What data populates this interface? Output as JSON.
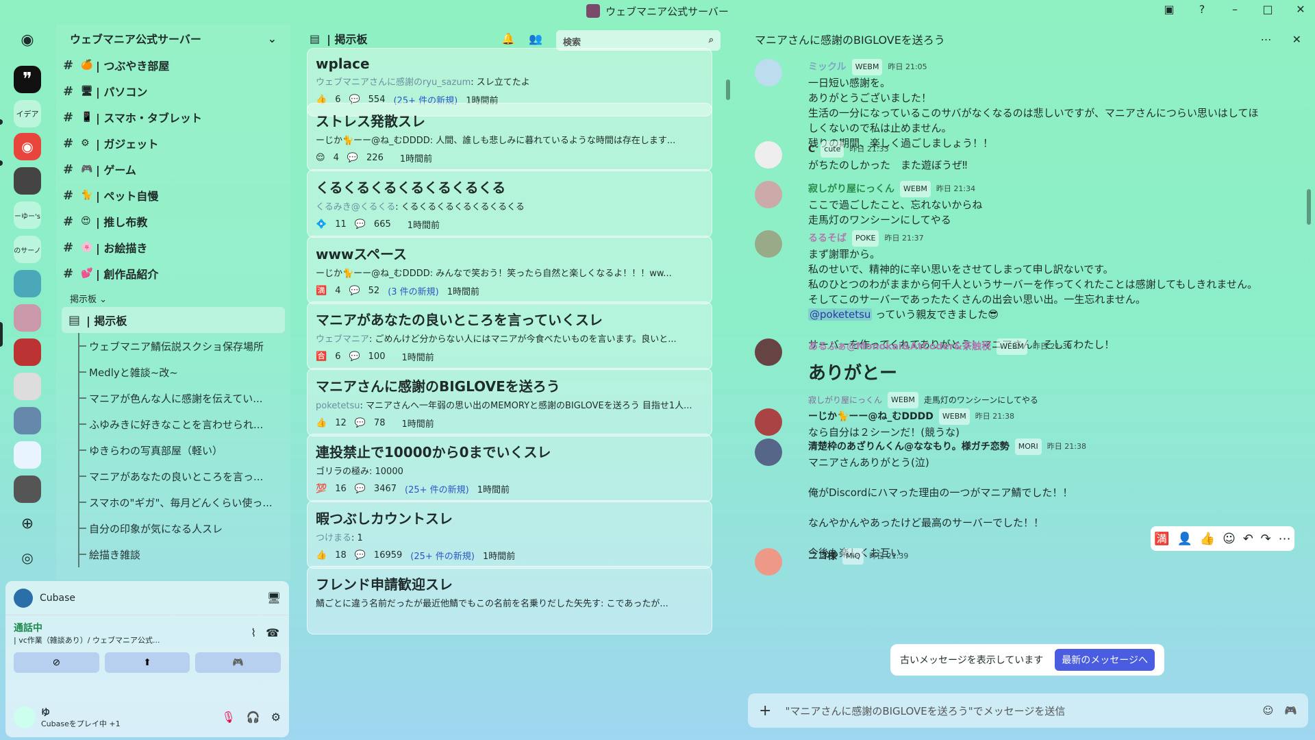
{
  "titlebar": {
    "title": "ウェブマニア公式サーバー"
  },
  "guilds": {
    "idea_label": "イデア",
    "item_a": "ーゆー's",
    "item_b": "のサーノ"
  },
  "server": {
    "name": "ウェブマニア公式サーバー"
  },
  "channels": [
    {
      "emoji": "🍊",
      "name": "| つぶやき部屋"
    },
    {
      "emoji": "🖥",
      "name": "| パソコン"
    },
    {
      "emoji": "📱",
      "name": "| スマホ・タブレット"
    },
    {
      "emoji": "⚙",
      "name": "| ガジェット"
    },
    {
      "emoji": "🎮",
      "name": "| ゲーム"
    },
    {
      "emoji": "🐈",
      "name": "| ペット自慢"
    },
    {
      "emoji": "😍",
      "name": "| 推し布教"
    },
    {
      "emoji": "🌸",
      "name": "| お絵描き"
    },
    {
      "emoji": "💕",
      "name": "| 創作品紹介"
    }
  ],
  "category": "掲示板",
  "active_channel": "| 掲示板",
  "threads": [
    "ウェブマニア鯖伝説スクショ保存場所",
    "Medlyと雑談~改~",
    "マニアが色んな人に感謝を伝えてい...",
    "ふゆみきに好きなことを言わせられ...",
    "ゆきらわの写真部屋（軽い）",
    "マニアがあなたの良いところを言っ...",
    "スマホの\"ギガ\"、毎月どんくらい使っ...",
    "自分の印象が気になる人スレ",
    "絵描き雑談"
  ],
  "userpanel": {
    "app": "Cubase",
    "call_status": "通話中",
    "call_channel": "| vc作業（雑談あり）/ ウェブマニア公式...",
    "username": "ゆ",
    "activity": "Cubaseをプレイ中 +1"
  },
  "forum": {
    "title": "| 掲示板",
    "search_placeholder": "検索",
    "posts": [
      {
        "title": "wplace",
        "author": "ウェブマニアさんに感謝のryu_sazum",
        "preview": ": スレ立てたよ",
        "reaction": "👍",
        "rcount": "6",
        "replies": "554",
        "new": "(25+ 件の新規)",
        "time": "1時間前"
      },
      {
        "title": "ストレス発散スレ",
        "author": "",
        "preview": "ーじか🐈ーー@ね_むDDDD: 人間、誰しも悲しみに暮れているような時間は存在します...",
        "reaction": "😌",
        "rcount": "4",
        "replies": "226",
        "new": "",
        "time": "1時間前"
      },
      {
        "title": "くるくるくるくるくるくるくる",
        "author": "くるみき@くるくる",
        "preview": ": くるくるくるくるくるくるくる",
        "reaction": "💠",
        "rcount": "11",
        "replies": "665",
        "new": "",
        "time": "1時間前"
      },
      {
        "title": "wwwスペース",
        "author": "",
        "preview": "ーじか🐈ーー@ね_むDDDD: みんなで笑おう！笑ったら自然と楽しくなるよ！！！ww...",
        "reaction": "🈵",
        "rcount": "4",
        "replies": "52",
        "new": "(3 件の新規)",
        "time": "1時間前"
      },
      {
        "title": "マニアがあなたの良いところを言っていくスレ",
        "author": "ウェブマニア",
        "preview": ": ごめんけど分からない人にはマニアが今食べたいものを言います。良いと...",
        "reaction": "🈴",
        "rcount": "6",
        "replies": "100",
        "new": "",
        "time": "1時間前"
      },
      {
        "title": "マニアさんに感謝のBIGLOVEを送ろう",
        "author": "poketetsu",
        "preview": ": マニアさんへ一年弱の思い出のMEMORYと感謝のBIGLOVEを送ろう 目指せ1人...",
        "reaction": "👍",
        "rcount": "12",
        "replies": "78",
        "new": "",
        "time": "1時間前"
      },
      {
        "title": "連投禁止で10000から0までいくスレ",
        "author": "",
        "preview": "ゴリラの極み: 10000",
        "reaction": "💯",
        "rcount": "16",
        "replies": "3467",
        "new": "(25+ 件の新規)",
        "time": "1時間前"
      },
      {
        "title": "暇つぶしカウントスレ",
        "author": "つけまる",
        "preview": ": 1",
        "reaction": "👍",
        "rcount": "18",
        "replies": "16959",
        "new": "(25+ 件の新規)",
        "time": "1時間前"
      },
      {
        "title": "フレンド申請歓迎スレ",
        "author": "",
        "preview": "鯖ごとに違う名前だったが最近他鯖でもこの名前を名乗りだした矢先す: こであったが...",
        "reaction": "",
        "rcount": "",
        "replies": "",
        "new": "",
        "time": ""
      }
    ]
  },
  "thread": {
    "title": "マニアさんに感謝のBIGLOVEを送ろう",
    "messages": [
      {
        "name": "ミックル",
        "tag": "WEBM",
        "ts": "昨日 21:05",
        "lines": [
          "一日短い感謝を。",
          "ありがとうございました！",
          "生活の一分になっているこのサバがなくなるのは悲しいですが、マニアさんにつらい思いはしてほ",
          "しくないので私は止めません。",
          "残りの期間、楽しく過ごしましょう！！"
        ]
      },
      {
        "name": "C",
        "tag": "cute",
        "ts": "昨日 21:33",
        "lines": [
          "がちたのしかった　また遊ぼうぜ‼"
        ]
      },
      {
        "name": "寂しがり屋にっくん",
        "tag": "WEBM",
        "ts": "昨日 21:34",
        "lines": [
          "ここで過ごしたこと、忘れないからね",
          "走馬灯のワンシーンにしてやる"
        ]
      },
      {
        "name": "るるそば",
        "tag": "POKE",
        "ts": "昨日 21:37",
        "lines": [
          "まず謝罪から。",
          "私のせいで、精神的に辛い思いをさせてしまって申し訳ないです。",
          "私のひとつのわがままから何千人というサーバーを作ってくれたことは感謝してもしきれません。",
          "そしてこのサーバーであったたくさんの出会い思い出。一生忘れません。"
        ],
        "mention": "@poketetsu",
        "mention_rest": " っていう親友できました😎",
        "extra": "サーバーを作ってくれてありがとう！マニアさん！そしてわたし！"
      },
      {
        "name": "あるふぁ@Monokai&AtCoder&茶触税",
        "tag": "WEBM",
        "ts": "昨日 21:38",
        "big": "ありがとー"
      },
      {
        "reply_name": "寂しがり屋にっくん",
        "reply_tag": "WEBM",
        "reply_text": "走馬灯のワンシーンにしてやる",
        "name": "ーじか🐈ーー@ね_むDDDD",
        "tag": "WEBM",
        "ts": "昨日 21:38",
        "lines": [
          "なら自分は２シーンだ！(競うな)"
        ]
      },
      {
        "name": "清楚枠のあざりんくん@ななもり。様ガチ恋勢",
        "tag": "MORI",
        "ts": "昨日 21:38",
        "lines": [
          "マニアさんありがとう(泣)",
          "",
          "俺がDiscordにハマった理由の一つがマニア鯖でした！！",
          "",
          "なんやかんやあったけど最高のサーバーでした！！",
          "",
          "今後も楽しくお互い"
        ]
      },
      {
        "name": "ニコ様",
        "tag": "MiQ",
        "ts": "昨日 21:39",
        "lines": [
          ""
        ]
      }
    ],
    "banner_text": "古いメッセージを表示しています",
    "banner_button": "最新のメッセージへ",
    "composer_placeholder": "\"マニアさんに感謝のBIGLOVEを送ろう\"でメッセージを送信"
  },
  "colors": {
    "accent": "#4a5ce0",
    "bg_top": "#8ff0c2",
    "bg_bottom": "#9fd6f0"
  }
}
